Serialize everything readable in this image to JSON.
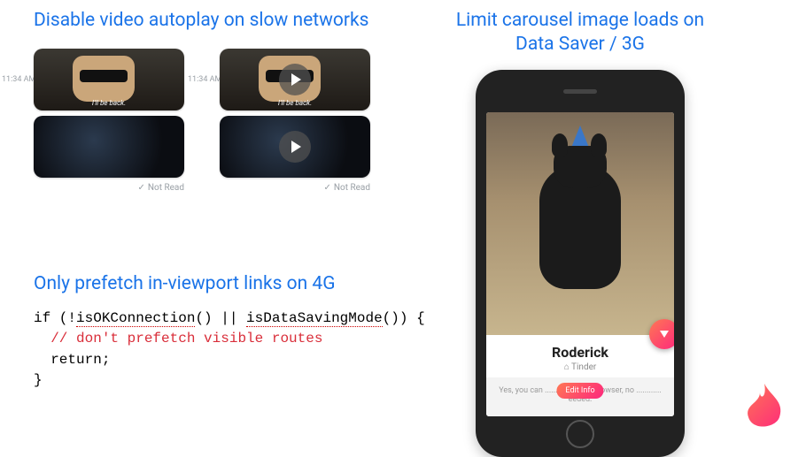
{
  "section1": {
    "heading": "Disable video autoplay on slow networks",
    "timestamp": "11:34 AM",
    "caption": "I'll be back.",
    "not_read": "Not Read"
  },
  "section2": {
    "heading": "Limit carousel image loads on Data Saver / 3G",
    "card_name": "Roderick",
    "card_sub": "Tinder",
    "promo_text": "Yes, you can .......... in your browser, no ............ eeded.",
    "pill": "Edit Info"
  },
  "section3": {
    "heading": "Only prefetch in-viewport links on 4G",
    "code_line1_a": "if (!",
    "code_line1_b": "isOKConnection",
    "code_line1_c": "() || ",
    "code_line1_d": "isDataSavingMode",
    "code_line1_e": "()) {",
    "code_line2": "  // don't prefetch visible routes",
    "code_line3": "  return;",
    "code_line4": "}"
  }
}
